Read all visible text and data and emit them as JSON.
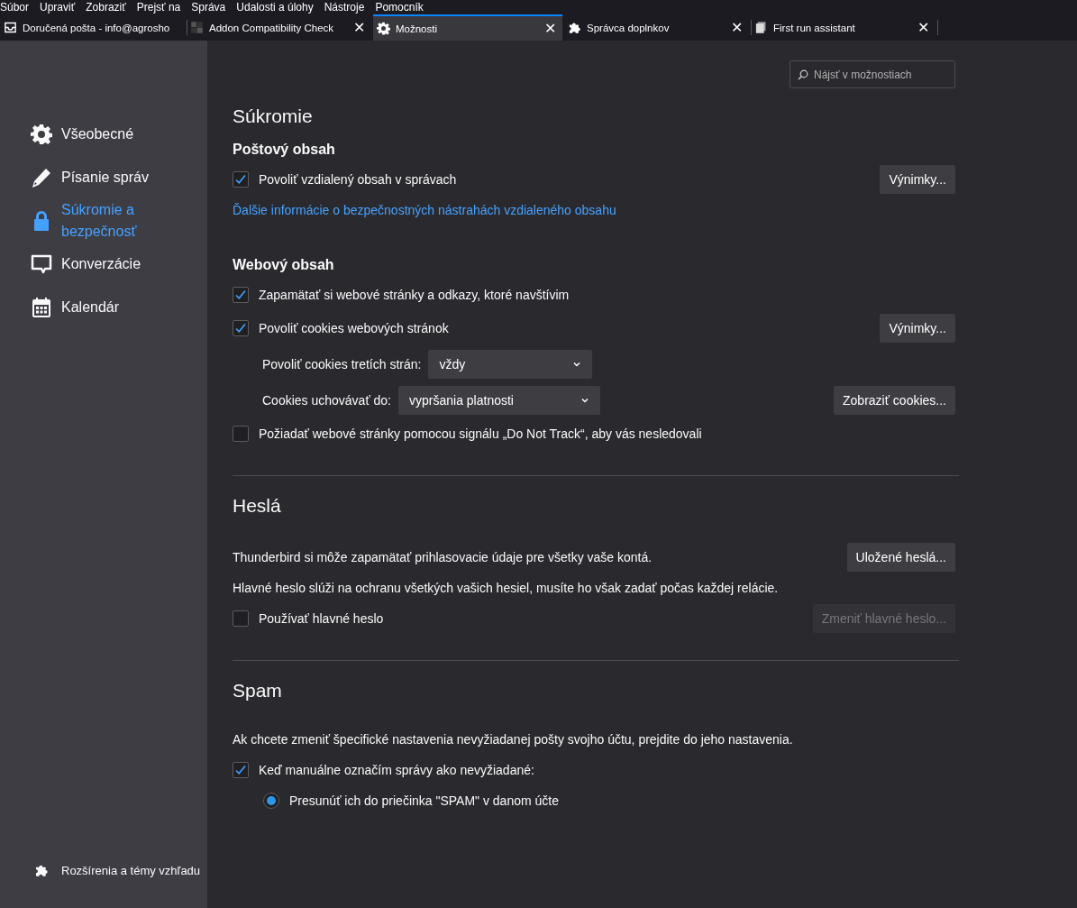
{
  "menu": [
    "Súbor",
    "Upraviť",
    "Zobraziť",
    "Prejsť na",
    "Správa",
    "Udalosti a úlohy",
    "Nástroje",
    "Pomocník"
  ],
  "tabs": [
    {
      "label": "Doručená pošta - info@agrosho",
      "selected": false
    },
    {
      "label": "Addon Compatibility Check",
      "selected": false,
      "close": "✕"
    },
    {
      "label": "Možnosti",
      "selected": true,
      "close": "✕"
    },
    {
      "label": "Správca doplnkov",
      "selected": false,
      "close": "✕"
    },
    {
      "label": "First run assistant",
      "selected": false,
      "close": "✕"
    }
  ],
  "search": {
    "placeholder": "Nájsť v možnostiach"
  },
  "sidebar": {
    "items": [
      {
        "label": "Všeobecné",
        "selected": false
      },
      {
        "label": "Písanie správ",
        "selected": false
      },
      {
        "label": "Súkromie a bezpečnosť",
        "selected": true
      },
      {
        "label": "Konverzácie",
        "selected": false
      },
      {
        "label": "Kalendár",
        "selected": false
      }
    ],
    "footer": {
      "label": "Rozšírenia a témy vzhľadu"
    }
  },
  "sections": [
    {
      "title": "Súkromie",
      "groups": [
        {
          "heading": "Poštový obsah",
          "rows": [
            {
              "kind": "checkbox",
              "label": "Povoliť vzdialený obsah v správach",
              "checked": true,
              "button": {
                "label": "Výnimky...",
                "disabled": false
              }
            },
            {
              "kind": "link",
              "label": "Ďalšie informácie o bezpečnostných nástrahách vzdialeného obsahu"
            }
          ]
        },
        {
          "heading": "Webový obsah",
          "rows": [
            {
              "kind": "checkbox",
              "label": "Zapamätať si webové stránky a odkazy, ktoré navštívim",
              "checked": true
            },
            {
              "kind": "checkbox",
              "label": "Povoliť cookies webových stránok",
              "checked": true,
              "button": {
                "label": "Výnimky...",
                "disabled": false
              }
            },
            {
              "kind": "select",
              "label": "Povoliť cookies tretích strán:",
              "value": "vždy"
            },
            {
              "kind": "select",
              "label": "Cookies uchovávať do:",
              "value": "vypršania platnosti",
              "button": {
                "label": "Zobraziť cookies...",
                "disabled": false
              }
            },
            {
              "kind": "checkbox",
              "label": "Požiadať webové stránky pomocou signálu „Do Not Track“, aby vás nesledovali",
              "checked": false
            }
          ]
        }
      ]
    },
    {
      "title": "Heslá",
      "groups": [
        {
          "rows": [
            {
              "kind": "text",
              "label": "Thunderbird si môže zapamätať prihlasovacie údaje pre všetky vaše kontá.",
              "button": {
                "label": "Uložené heslá...",
                "disabled": false
              }
            },
            {
              "kind": "text",
              "label": "Hlavné heslo slúži na ochranu všetkých vašich hesiel, musíte ho však zadať počas každej relácie."
            },
            {
              "kind": "checkbox",
              "label": "Používať hlavné heslo",
              "checked": false,
              "button": {
                "label": "Zmeniť hlavné heslo...",
                "disabled": true
              }
            }
          ]
        }
      ]
    },
    {
      "title": "Spam",
      "groups": [
        {
          "rows": [
            {
              "kind": "text",
              "label": "Ak chcete zmeniť špecifické nastavenia nevyžiadanej pošty svojho účtu, prejdite do jeho nastavenia."
            },
            {
              "kind": "checkbox",
              "label": "Keď manuálne označím správy ako nevyžiadané:",
              "checked": true
            },
            {
              "kind": "radio",
              "label": "Presunúť ich do priečinka \"SPAM\" v danom účte",
              "selected": true
            }
          ]
        }
      ]
    }
  ]
}
